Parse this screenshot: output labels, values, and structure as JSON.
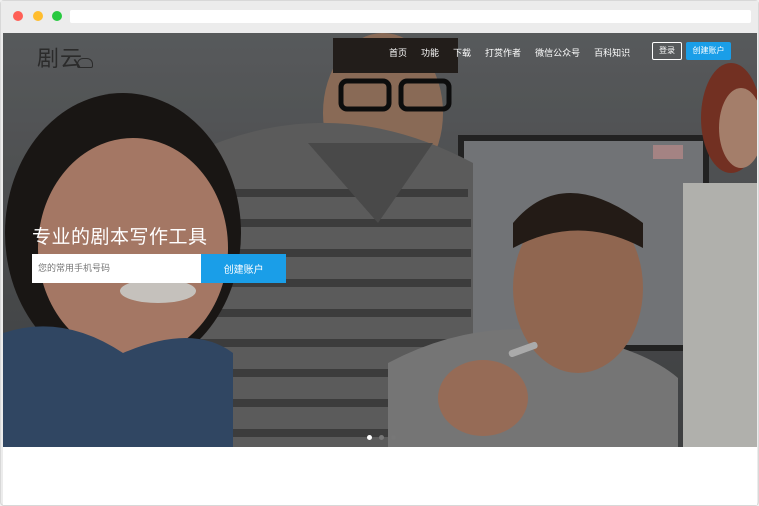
{
  "brand": {
    "logo_text": "剧云"
  },
  "nav": {
    "items": [
      "首页",
      "功能",
      "下载",
      "打赏作者",
      "微信公众号",
      "百科知识"
    ],
    "login_label": "登录",
    "create_label": "创建账户"
  },
  "hero": {
    "headline": "专业的剧本写作工具",
    "phone_placeholder": "您的常用手机号码",
    "submit_label": "创建账户",
    "slide_count": 3,
    "active_slide": 1
  },
  "colors": {
    "accent": "#1a9ee8"
  }
}
